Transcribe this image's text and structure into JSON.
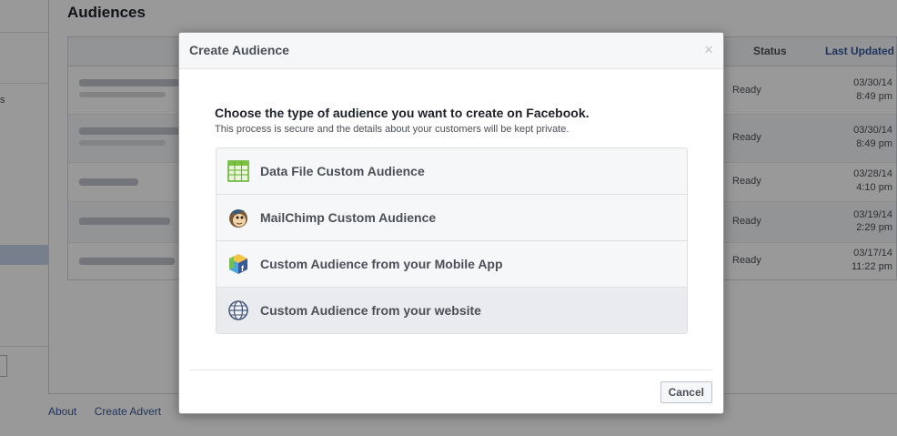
{
  "background": {
    "left_fragment": "s",
    "page_title": "Audiences",
    "table": {
      "columns": {
        "status": "Status",
        "last_updated": "Last Updated"
      },
      "rows": [
        {
          "status": "Ready",
          "date": "03/30/14",
          "time": "8:49 pm"
        },
        {
          "status": "Ready",
          "date": "03/30/14",
          "time": "8:49 pm"
        },
        {
          "status": "Ready",
          "date": "03/28/14",
          "time": "4:10 pm"
        },
        {
          "status": "Ready",
          "date": "03/19/14",
          "time": "2:29 pm"
        },
        {
          "status": "Ready",
          "date": "03/17/14",
          "time": "11:22 pm"
        }
      ]
    },
    "footer_links": [
      "About",
      "Create Advert"
    ]
  },
  "dialog": {
    "title": "Create Audience",
    "heading": "Choose the type of audience you want to create on Facebook.",
    "subheading": "This process is secure and the details about your customers will be kept private.",
    "options": [
      {
        "label": "Data File Custom Audience",
        "icon": "spreadsheet-icon"
      },
      {
        "label": "MailChimp Custom Audience",
        "icon": "mailchimp-icon"
      },
      {
        "label": "Custom Audience from your Mobile App",
        "icon": "mobile-app-cube-icon"
      },
      {
        "label": "Custom Audience from your website",
        "icon": "globe-icon"
      }
    ],
    "cancel_label": "Cancel",
    "close_glyph": "×"
  },
  "colors": {
    "link": "#365899",
    "overlay": "rgba(0,0,0,0.40)",
    "option_hover": "#e9ebee"
  }
}
